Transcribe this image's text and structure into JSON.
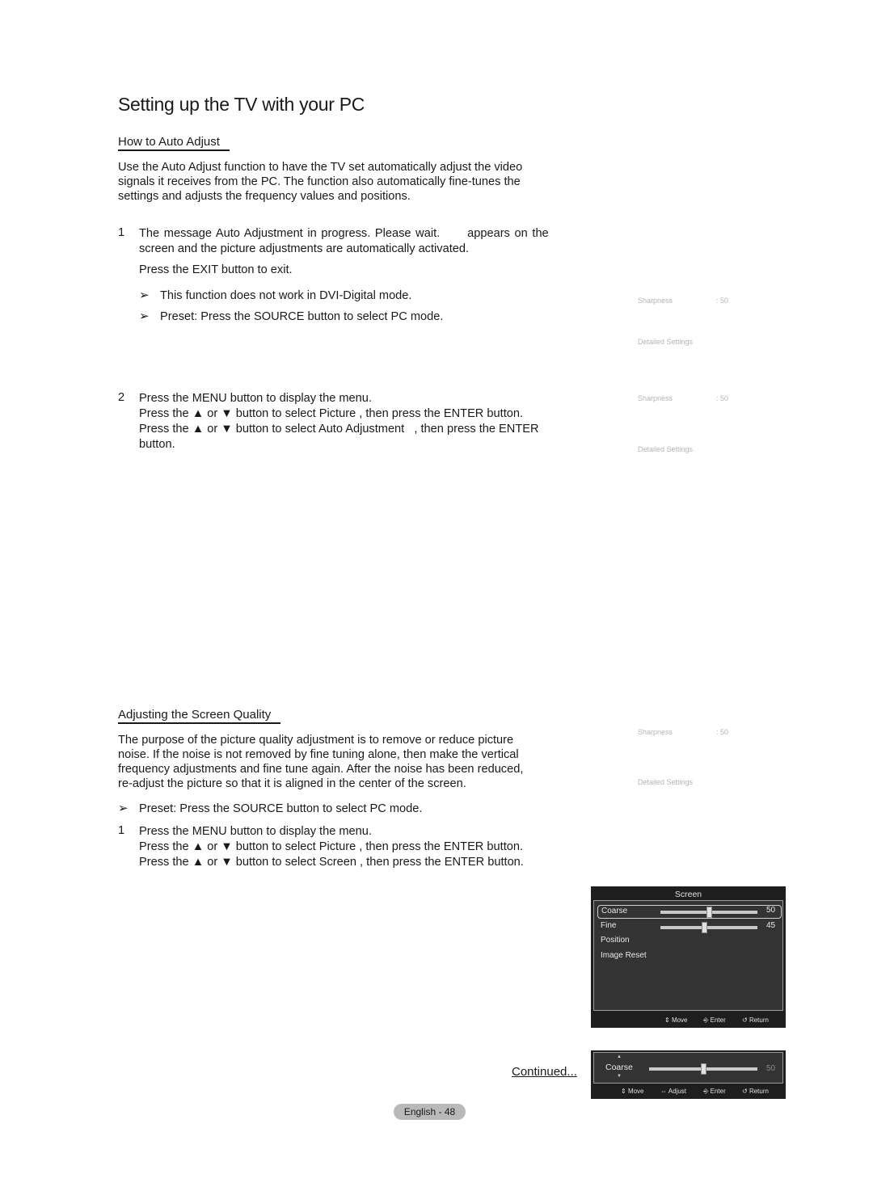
{
  "page": {
    "title": "Setting up the TV with your PC",
    "continued": "Continued...",
    "page_label": "English - 48"
  },
  "auto_adjust": {
    "heading": "How to Auto Adjust",
    "intro": [
      "Use the Auto Adjust function to have the TV set automatically adjust the video",
      "signals it receives from the PC. The function also automatically fine-tunes the",
      "settings and adjusts the frequency values and positions."
    ],
    "step1": {
      "num": "1",
      "line1": "The message Auto Adjustment in progress. Please wait.      appears on the",
      "line2": "screen and the picture adjustments are automatically activated.",
      "line3": "Press the EXIT button to exit.",
      "notes": [
        "This function does not work in DVI-Digital mode.",
        "Preset: Press the SOURCE button to select PC mode."
      ]
    },
    "step2": {
      "num": "2",
      "lines": [
        "Press the MENU button to display the menu.",
        "Press the ▲ or ▼ button to select Picture , then press the ENTER button.",
        "Press the ▲ or ▼ button to select Auto Adjustment   , then press the ENTER",
        "button."
      ]
    }
  },
  "screen_quality": {
    "heading": "Adjusting the Screen Quality",
    "intro": [
      "The purpose of the picture quality adjustment is to remove or reduce picture",
      "noise. If the noise is not removed by fine tuning alone, then make the vertical",
      "frequency adjustments and fine tune again. After the noise has been reduced,",
      "re-adjust the picture so that it is aligned in the center of the screen."
    ],
    "note": "Preset: Press the SOURCE button to select PC mode.",
    "step1": {
      "num": "1",
      "lines": [
        "Press the MENU button to display the menu.",
        "Press the ▲ or ▼ button to select Picture , then press the ENTER button.",
        "Press the ▲ or ▼ button to select Screen , then press the ENTER button."
      ]
    }
  },
  "ghost_menus": [
    {
      "sharpness_label": "Sharpness",
      "sharpness_value": ": 50",
      "detailed": "Detailed Settings"
    },
    {
      "sharpness_label": "Sharpness",
      "sharpness_value": ": 50",
      "detailed": "Detailed Settings"
    },
    {
      "sharpness_label": "Sharpness",
      "sharpness_value": ": 50",
      "detailed": "Detailed Settings"
    }
  ],
  "screen_menu": {
    "title": "Screen",
    "items": [
      {
        "label": "Coarse",
        "value": "50",
        "level": 50,
        "selected": true
      },
      {
        "label": "Fine",
        "value": "45",
        "level": 45,
        "selected": false
      },
      {
        "label": "Position"
      },
      {
        "label": "Image Reset"
      }
    ],
    "footer": {
      "move": "Move",
      "enter": "Enter",
      "return": "Return"
    }
  },
  "coarse_popup": {
    "label": "Coarse",
    "value": "50",
    "level": 50,
    "footer": {
      "move": "Move",
      "adjust": "Adjust",
      "enter": "Enter",
      "return": "Return"
    }
  }
}
